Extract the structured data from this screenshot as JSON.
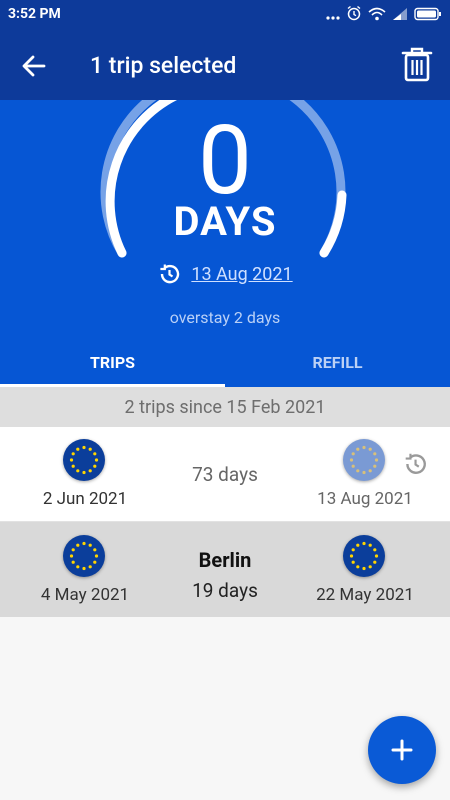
{
  "status_bar": {
    "time": "3:52 PM",
    "icons": [
      "more-icon",
      "alarm-icon",
      "wifi-icon",
      "signal-icon",
      "battery-icon"
    ]
  },
  "app_bar": {
    "title": "1 trip selected",
    "back_icon": "arrow-left-icon",
    "delete_icon": "trash-icon"
  },
  "hero": {
    "days_number": "0",
    "days_label": "DAYS",
    "date_link": "13 Aug 2021",
    "overstay": "overstay 2 days"
  },
  "tabs": [
    {
      "label": "TRIPS",
      "selected": true
    },
    {
      "label": "REFILL",
      "selected": false
    }
  ],
  "summary": "2 trips since 15 Feb 2021",
  "trips": [
    {
      "name": "",
      "start_date": "2 Jun 2021",
      "duration": "73 days",
      "end_date": "13 Aug 2021",
      "end_is_history": true,
      "selected": false
    },
    {
      "name": "Berlin",
      "start_date": "4 May 2021",
      "duration": "19 days",
      "end_date": "22 May 2021",
      "end_is_history": false,
      "selected": true
    }
  ],
  "fab": {
    "icon": "plus-icon"
  },
  "colors": {
    "app_bar": "#0d3a9a",
    "hero": "#0656d4",
    "eu_blue": "#0b3e9b",
    "eu_star": "#ffd500",
    "fab": "#0a5ad6"
  }
}
